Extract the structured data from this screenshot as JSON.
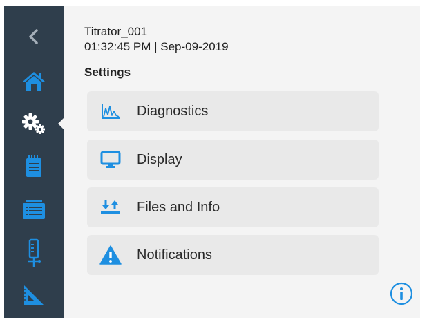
{
  "header": {
    "device_name": "Titrator_001",
    "datetime": "01:32:45 PM | Sep-09-2019"
  },
  "section_title": "Settings",
  "sidebar": {
    "items": [
      {
        "name": "back",
        "icon": "chevron-left-icon"
      },
      {
        "name": "home",
        "icon": "home-icon"
      },
      {
        "name": "settings",
        "icon": "gears-icon",
        "active": true
      },
      {
        "name": "methods",
        "icon": "notepad-icon"
      },
      {
        "name": "results",
        "icon": "folder-list-icon"
      },
      {
        "name": "burette",
        "icon": "burette-icon"
      },
      {
        "name": "calibration",
        "icon": "set-square-icon"
      }
    ]
  },
  "menu": {
    "items": [
      {
        "label": "Diagnostics",
        "icon": "chart-icon"
      },
      {
        "label": "Display",
        "icon": "monitor-icon"
      },
      {
        "label": "Files and Info",
        "icon": "transfer-icon"
      },
      {
        "label": "Notifications",
        "icon": "warning-icon"
      }
    ]
  },
  "colors": {
    "sidebar": "#2f3e4c",
    "accent": "#1e8fe1",
    "background": "#f4f4f4",
    "menu_item": "#e9e9e9"
  }
}
